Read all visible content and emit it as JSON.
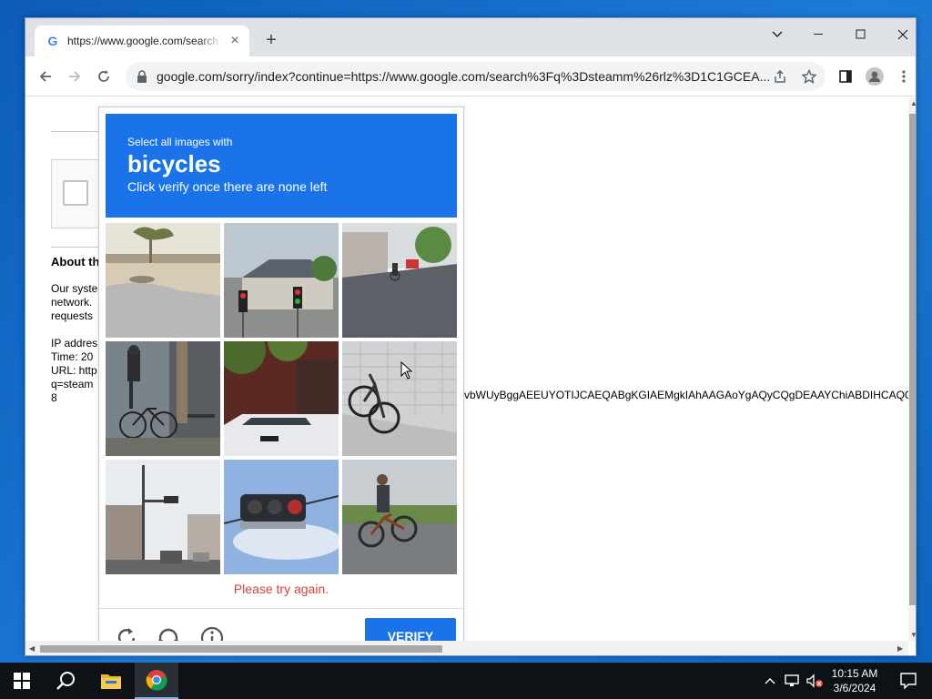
{
  "browser": {
    "tab_title": "https://www.google.com/search?q=steamm&rlz",
    "url": "google.com/sorry/index?continue=https://www.google.com/search%3Fq%3Dsteamm%26rlz%3D1C1GCEA...",
    "favicon_letter": "G",
    "new_tab_label": "+"
  },
  "page": {
    "about_title": "About th",
    "para_lines": [
      "Our syste",
      "network.",
      "requests"
    ],
    "ip_line": "IP addres",
    "time_line": "Time: 20",
    "url_line": "URL: http",
    "q_line": "q=steam",
    "num_line": "8",
    "long_text": "vbWUyBggAEEUYOTIJCAEQABgKGIAEMgkIAhAAGAoYgAQyCQgDEAAYChiABDIHCAQQ"
  },
  "captcha": {
    "instruction_top": "Select all images with",
    "keyword": "bicycles",
    "instruction_bottom": "Click verify once there are none left",
    "error": "Please try again.",
    "verify_label": "VERIFY",
    "tiles": [
      "street-shadow",
      "traffic-lights-house",
      "street-cyclist-far",
      "bicycle-rack-person",
      "car-wall",
      "bicycle-parked-wall",
      "street-pole-traffic",
      "traffic-light-sky",
      "cyclist-riding"
    ]
  },
  "taskbar": {
    "time": "10:15 AM",
    "date": "3/6/2024"
  },
  "colors": {
    "captcha_blue": "#1a73e8",
    "error_red": "#d0443e",
    "chrome_tabstrip": "#dee1e6"
  }
}
